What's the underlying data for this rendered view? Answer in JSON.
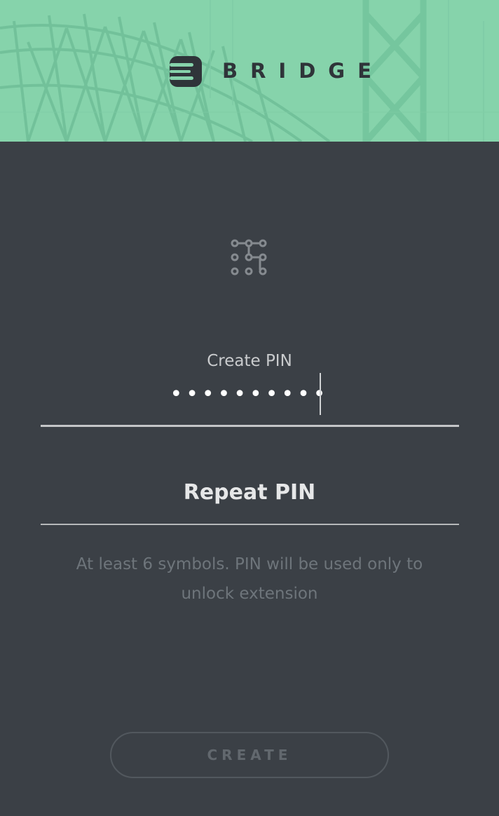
{
  "header": {
    "brand_name": "BRIDGE",
    "background_color": "#86d3ab",
    "logo_icon": "bridge-logo-icon",
    "image": "bridge-photo"
  },
  "form": {
    "icon": "pattern-lock-icon",
    "create_pin_label": "Create PIN",
    "create_pin_value": "••••••••••",
    "repeat_pin_placeholder": "Repeat PIN",
    "hint": "At least 6 symbols. PIN will be used only to unlock extension",
    "create_button_label": "CREATE"
  },
  "colors": {
    "panel": "#3b4046",
    "accent": "#86d3ab"
  }
}
